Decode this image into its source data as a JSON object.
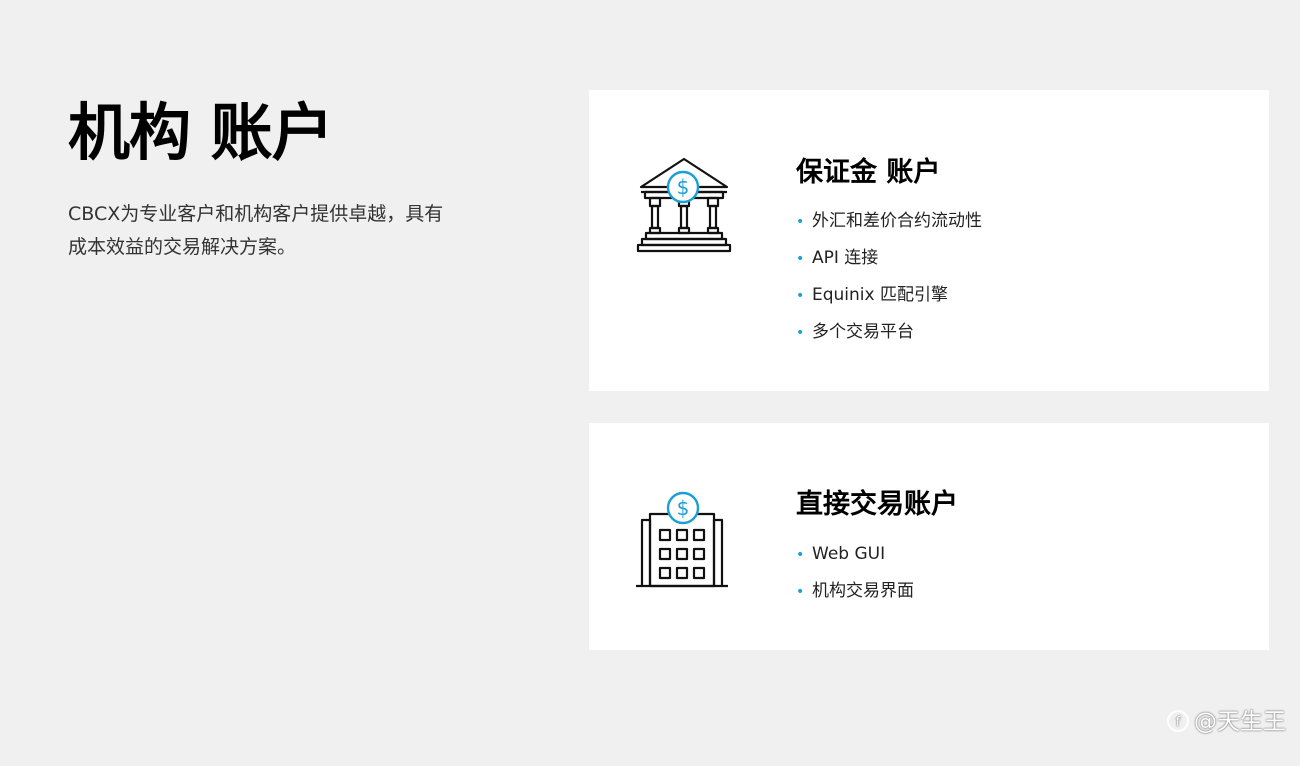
{
  "intro": {
    "title": "机构 账户",
    "description": "CBCX为专业客户和机构客户提供卓越，具有成本效益的交易解决方案。"
  },
  "cards": [
    {
      "icon": "bank-dollar-icon",
      "title": "保证金 账户",
      "items": [
        "外汇和差价合约流动性",
        "API 连接",
        "Equinix 匹配引擎",
        "多个交易平台"
      ]
    },
    {
      "icon": "office-building-dollar-icon",
      "title": "直接交易账户",
      "items": [
        "Web GUI",
        "机构交易界面"
      ]
    }
  ],
  "watermark": {
    "text": "@天生王"
  },
  "colors": {
    "accent": "#1a9fd6",
    "background": "#f0f0f0",
    "card": "#ffffff"
  }
}
